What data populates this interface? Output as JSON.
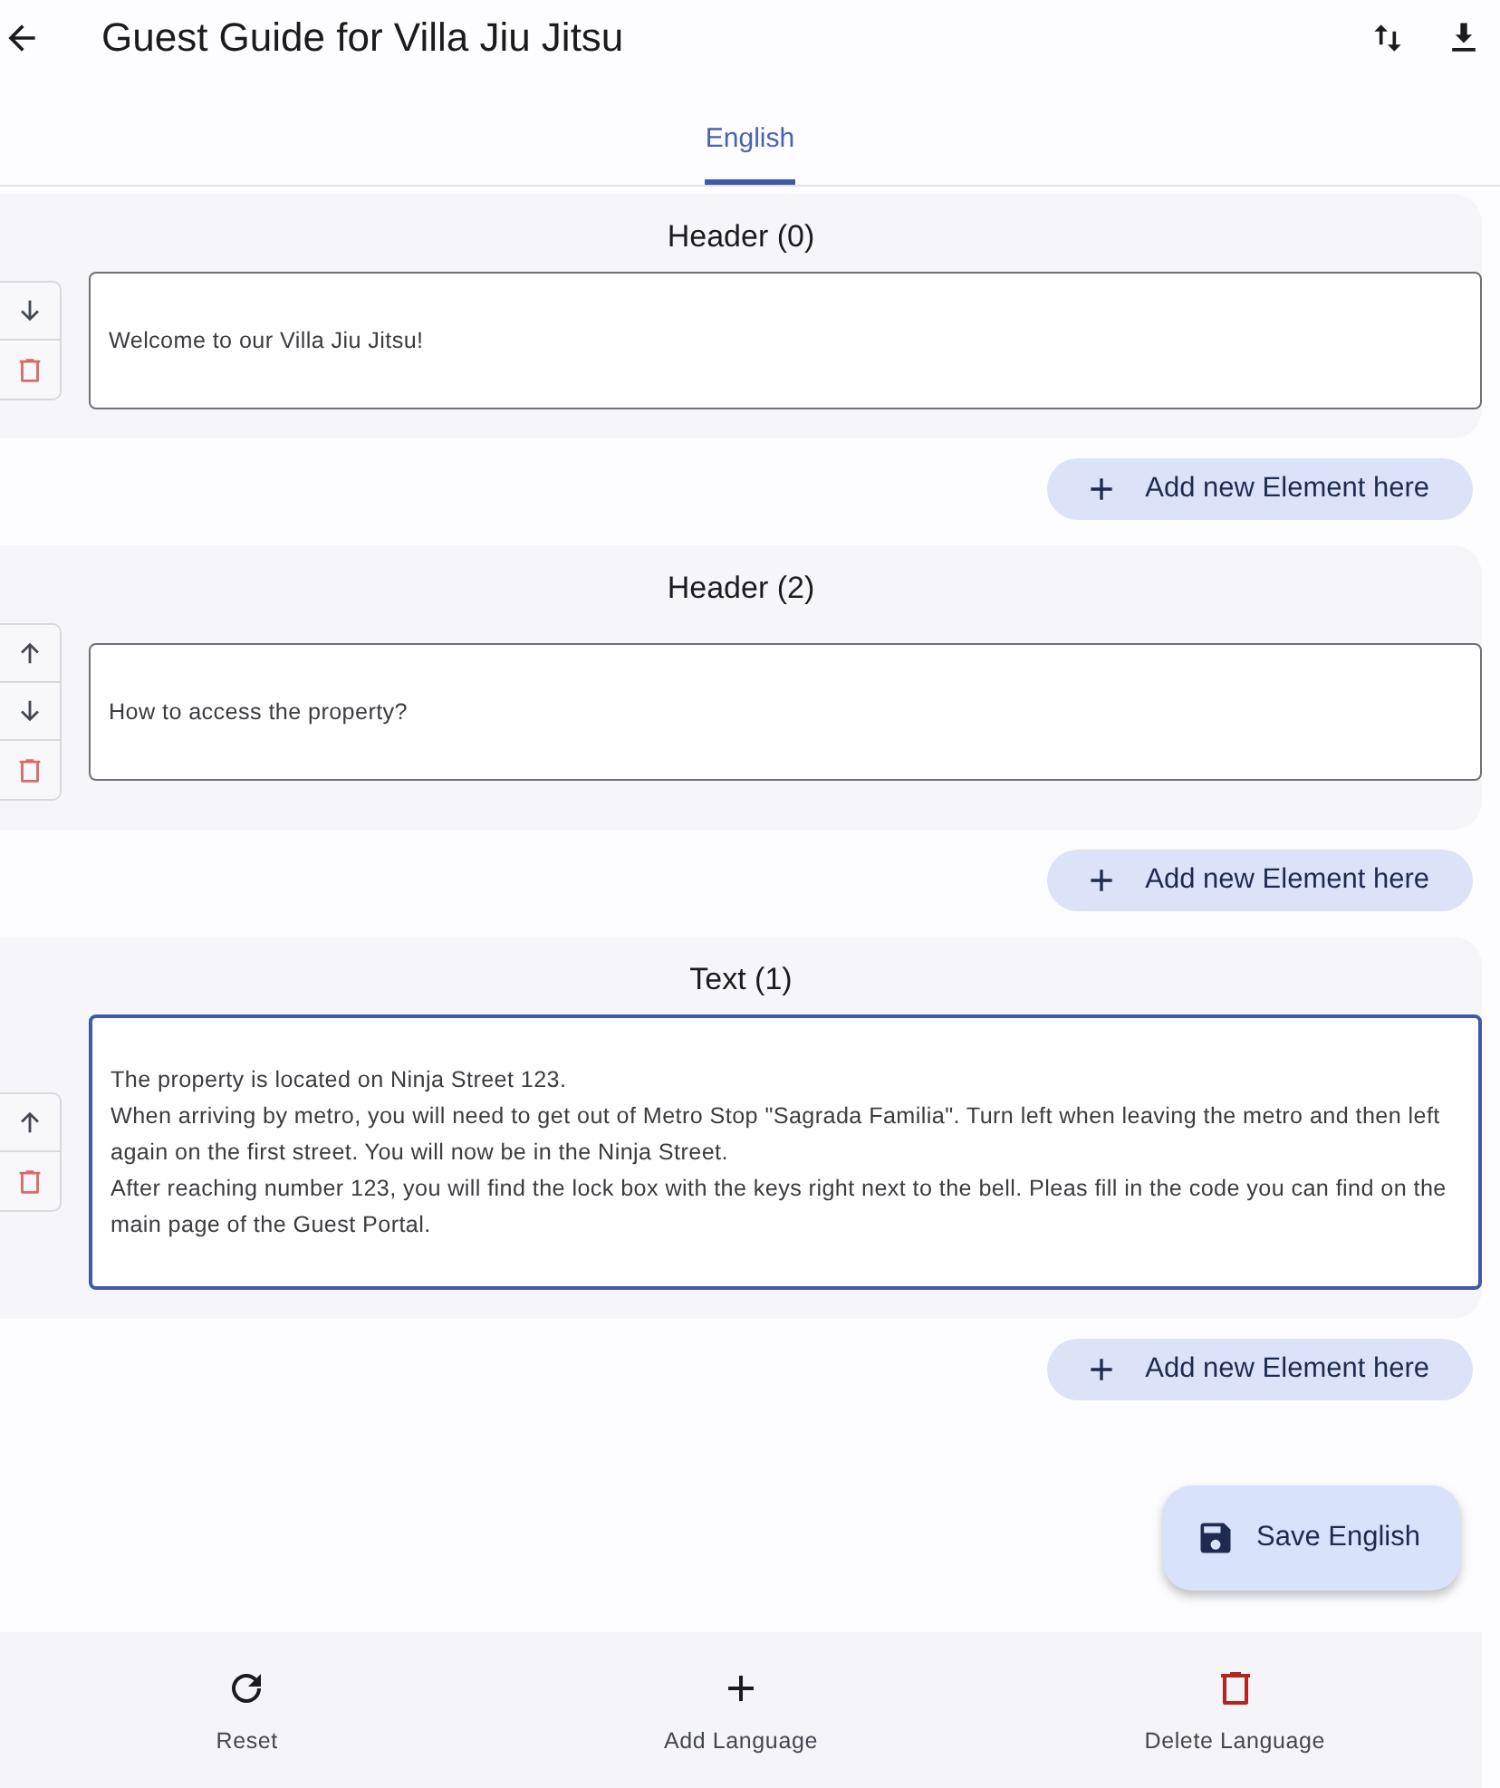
{
  "app_bar": {
    "title": "Guest Guide for Villa Jiu Jitsu"
  },
  "tabs": [
    {
      "label": "English",
      "selected": true
    }
  ],
  "blocks": [
    {
      "title": "Header (0)",
      "actions": [
        {
          "kind": "down"
        },
        {
          "kind": "delete"
        }
      ],
      "value": "Welcome to our Villa Jiu Jitsu!",
      "focused": false,
      "add_button": "Add new Element here"
    },
    {
      "title": "Header (2)",
      "actions": [
        {
          "kind": "up"
        },
        {
          "kind": "down"
        },
        {
          "kind": "delete"
        }
      ],
      "value": "How to access the property?",
      "focused": false,
      "add_button": "Add new Element here"
    },
    {
      "title": "Text (1)",
      "actions": [
        {
          "kind": "up"
        },
        {
          "kind": "delete"
        }
      ],
      "value": "The property is located on Ninja Street 123.\nWhen arriving by metro, you will need to get out of Metro Stop \"Sagrada Familia\". Turn left when leaving the metro and then left again on the first street. You will now be in the Ninja Street.\nAfter reaching number 123, you will find the lock box with the keys right next to the bell. Pleas fill in the code you can find on the main page of the Guest Portal.",
      "focused": true,
      "add_button": "Add new Element here"
    }
  ],
  "save_button": "Save English",
  "bottom_bar": [
    {
      "kind": "reset",
      "label": "Reset"
    },
    {
      "kind": "add",
      "label": "Add Language"
    },
    {
      "kind": "delete",
      "label": "Delete Language"
    }
  ]
}
